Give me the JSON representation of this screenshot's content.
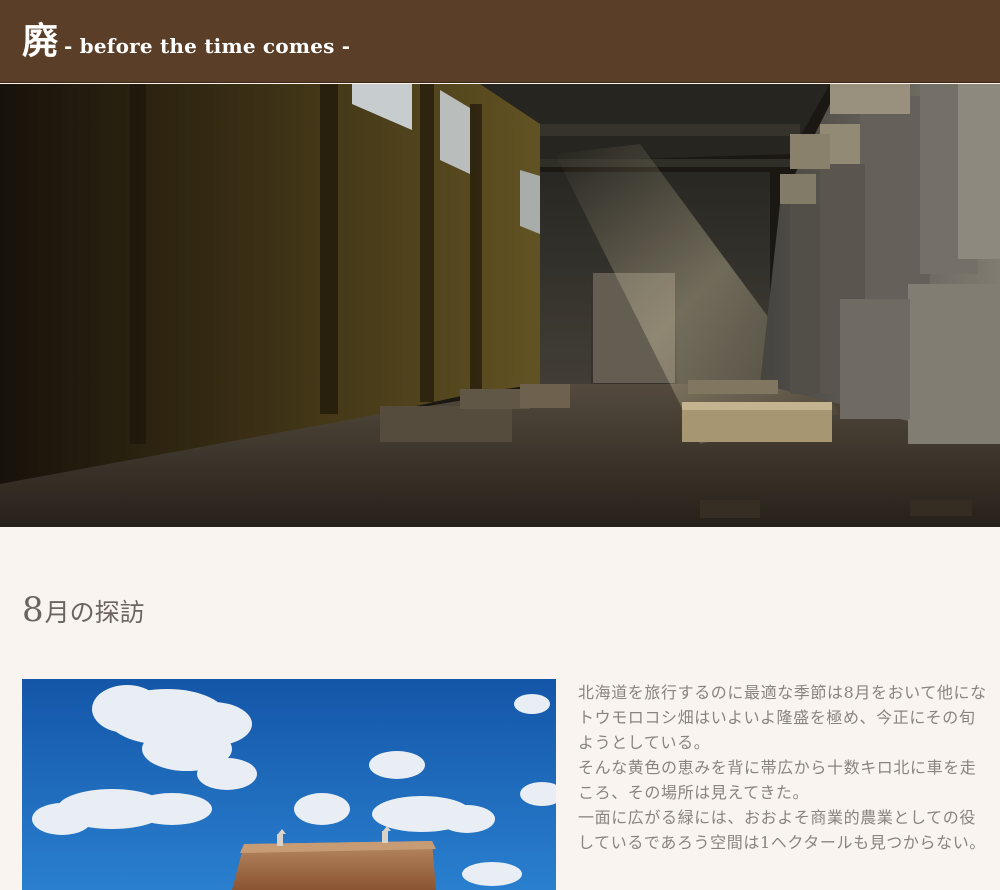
{
  "header": {
    "logo_kanji": "廃",
    "tagline": "- before the time comes -"
  },
  "hero": {
    "image_subject": "abandoned-factory-hall"
  },
  "section": {
    "heading_month": "8",
    "heading_rest": "月の探訪",
    "image_subject": "barn-under-blue-sky",
    "paragraphs": [
      "北海道を旅行するのに最適な季節は8月をおいて他にな",
      "トウモロコシ畑はいよいよ隆盛を極め、今正にその旬",
      "ようとしている。",
      "そんな黄色の恵みを背に帯広から十数キロ北に車を走",
      "ころ、その場所は見えてきた。",
      "一面に広がる緑には、おおよそ商業的農業としての役",
      "しているであろう空間は1ヘクタールも見つからない。"
    ]
  },
  "colors": {
    "header_bg": "#5a3e27",
    "page_bg": "#faf4f0",
    "heading_text": "#6b6460",
    "body_text": "#8a8480"
  }
}
